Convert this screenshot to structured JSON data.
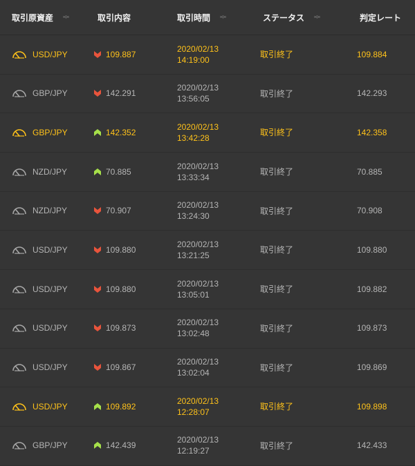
{
  "header": {
    "asset": "取引原資産",
    "content": "取引内容",
    "time": "取引時間",
    "status": "ステータス",
    "rate": "判定レート"
  },
  "colors": {
    "highlight": "#ffc21a",
    "down": "#e8543c",
    "up": "#a6e04a",
    "text": "#b5b5b5",
    "background": "#353535"
  },
  "rows": [
    {
      "asset": "USD/JPY",
      "direction": "down",
      "price": "109.887",
      "date": "2020/02/13",
      "time": "14:19:00",
      "status": "取引終了",
      "rate": "109.884",
      "highlight": true
    },
    {
      "asset": "GBP/JPY",
      "direction": "down",
      "price": "142.291",
      "date": "2020/02/13",
      "time": "13:56:05",
      "status": "取引終了",
      "rate": "142.293",
      "highlight": false
    },
    {
      "asset": "GBP/JPY",
      "direction": "up",
      "price": "142.352",
      "date": "2020/02/13",
      "time": "13:42:28",
      "status": "取引終了",
      "rate": "142.358",
      "highlight": true
    },
    {
      "asset": "NZD/JPY",
      "direction": "up",
      "price": "70.885",
      "date": "2020/02/13",
      "time": "13:33:34",
      "status": "取引終了",
      "rate": "70.885",
      "highlight": false
    },
    {
      "asset": "NZD/JPY",
      "direction": "down",
      "price": "70.907",
      "date": "2020/02/13",
      "time": "13:24:30",
      "status": "取引終了",
      "rate": "70.908",
      "highlight": false
    },
    {
      "asset": "USD/JPY",
      "direction": "down",
      "price": "109.880",
      "date": "2020/02/13",
      "time": "13:21:25",
      "status": "取引終了",
      "rate": "109.880",
      "highlight": false
    },
    {
      "asset": "USD/JPY",
      "direction": "down",
      "price": "109.880",
      "date": "2020/02/13",
      "time": "13:05:01",
      "status": "取引終了",
      "rate": "109.882",
      "highlight": false
    },
    {
      "asset": "USD/JPY",
      "direction": "down",
      "price": "109.873",
      "date": "2020/02/13",
      "time": "13:02:48",
      "status": "取引終了",
      "rate": "109.873",
      "highlight": false
    },
    {
      "asset": "USD/JPY",
      "direction": "down",
      "price": "109.867",
      "date": "2020/02/13",
      "time": "13:02:04",
      "status": "取引終了",
      "rate": "109.869",
      "highlight": false
    },
    {
      "asset": "USD/JPY",
      "direction": "up",
      "price": "109.892",
      "date": "2020/02/13",
      "time": "12:28:07",
      "status": "取引終了",
      "rate": "109.898",
      "highlight": true
    },
    {
      "asset": "GBP/JPY",
      "direction": "up",
      "price": "142.439",
      "date": "2020/02/13",
      "time": "12:19:27",
      "status": "取引終了",
      "rate": "142.433",
      "highlight": false
    }
  ]
}
